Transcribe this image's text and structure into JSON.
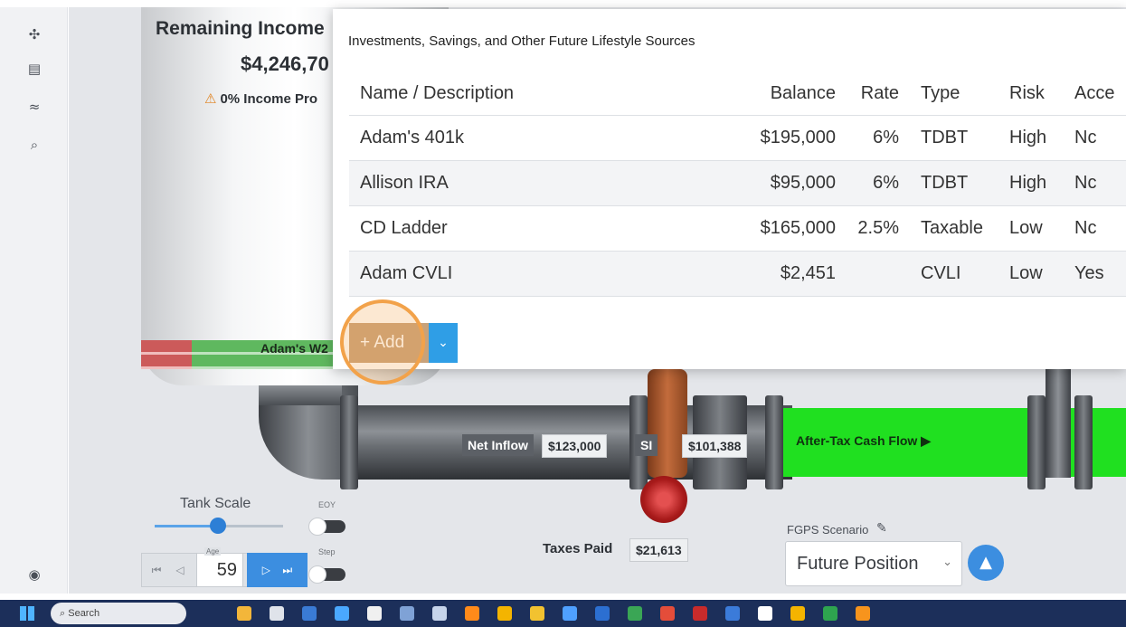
{
  "sidebar": {
    "items": [
      {
        "name": "scenarios-icon",
        "glyph": "✣"
      },
      {
        "name": "documents-icon",
        "glyph": "▤"
      },
      {
        "name": "feed-icon",
        "glyph": "≈"
      },
      {
        "name": "search-analysis-icon",
        "glyph": "⌕"
      }
    ],
    "bottom_icon": {
      "name": "camera-icon",
      "glyph": "◉"
    }
  },
  "tank": {
    "title": "Remaining Income",
    "value": "$4,246,70",
    "warning": "0% Income Pro",
    "warning_icon": "⚠",
    "bar_label": "Adam's W2"
  },
  "flow": {
    "net_inflow_label": "Net Inflow",
    "net_inflow_value": "$123,000",
    "si_label": "SI",
    "si_value": "$101,388",
    "cash_flow_label": "After-Tax Cash Flow ▶",
    "taxes_label": "Taxes Paid",
    "taxes_value": "$21,613"
  },
  "controls": {
    "tank_scale_label": "Tank Scale",
    "tank_scale_value": 0.5,
    "eoy_label": "EOY",
    "step_label": "Step",
    "age_label": "Age",
    "age_value": "59",
    "age_prev_first": "⏮",
    "age_prev": "◁",
    "age_next": "▷",
    "age_next_last": "⏭",
    "scenario_label": "FGPS Scenario",
    "scenario_edit_icon": "✎",
    "scenario_value": "Future Position",
    "alert_glyph": "▲"
  },
  "modal": {
    "title": "Investments, Savings, and Other Future Lifestyle Sources",
    "columns": [
      "Name / Description",
      "Balance",
      "Rate",
      "Type",
      "Risk",
      "Acce"
    ],
    "rows": [
      [
        "Adam's 401k",
        "$195,000",
        "6%",
        "TDBT",
        "High",
        "Nc"
      ],
      [
        "Allison IRA",
        "$95,000",
        "6%",
        "TDBT",
        "High",
        "Nc"
      ],
      [
        "CD Ladder",
        "$165,000",
        "2.5%",
        "Taxable",
        "Low",
        "Nc"
      ],
      [
        "Adam CVLI",
        "$2,451",
        "",
        "CVLI",
        "Low",
        "Yes"
      ]
    ],
    "add_label": "+ Add",
    "add_caret": "⌄"
  },
  "taskbar": {
    "search_placeholder": "Search",
    "icons": [
      "#f3b63a",
      "#dfe3ea",
      "#3a7bd5",
      "#4aa8ff",
      "#f0f0f0",
      "#7fa2d6",
      "#c6d4ea",
      "#ff8a1a",
      "#f4b400",
      "#f2c230",
      "#4fa0ff",
      "#2c6fd1",
      "#3aa655",
      "#e44d3a",
      "#c82b2b",
      "#3b7bd9",
      "#ffffff",
      "#f4b400",
      "#2ea44f",
      "#f7941d"
    ]
  }
}
